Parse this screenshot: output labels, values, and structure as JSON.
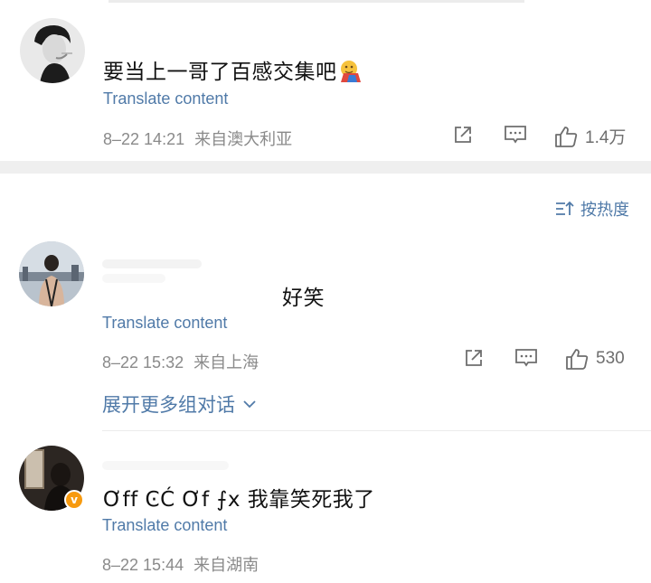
{
  "comments": [
    {
      "text": "要当上一哥了百感交集吧",
      "translate": "Translate content",
      "time": "8–22 14:21",
      "location": "来自澳大利亚",
      "likes": "1.4万"
    },
    {
      "text": "好笑",
      "translate": "Translate content",
      "time": "8–22 15:32",
      "location": "来自上海",
      "likes": "530"
    },
    {
      "text": "Ơff ϾĆ Ơf ⨍x 我靠笑死我了",
      "translate": "Translate content",
      "time": "8–22 15:44",
      "location": "来自湖南",
      "badge": "v"
    }
  ],
  "sort": {
    "label": "按热度"
  },
  "expand": {
    "label": "展开更多组对话"
  },
  "colors": {
    "link": "#507aa8",
    "meta": "#8a8a8a",
    "badge": "#f79a0f"
  }
}
